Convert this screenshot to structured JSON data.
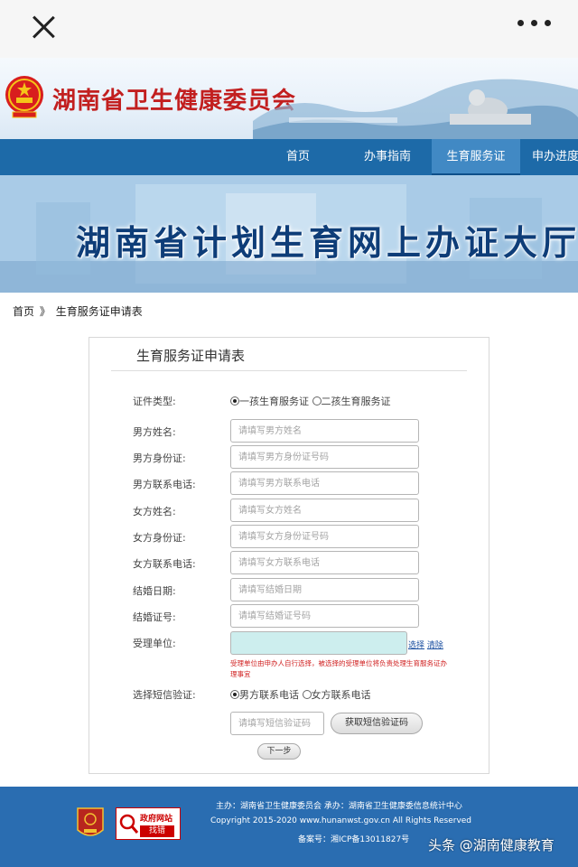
{
  "header": {
    "site_title": "湖南省卫生健康委员会"
  },
  "nav": {
    "items": [
      {
        "label": "首页"
      },
      {
        "label": "办事指南"
      },
      {
        "label": "生育服务证"
      },
      {
        "label": "申办进度查"
      }
    ],
    "active_index": 2
  },
  "banner": {
    "title": "湖南省计划生育网上办证大厅"
  },
  "breadcrumb": {
    "home": "首页",
    "separator": "》",
    "current": "生育服务证申请表"
  },
  "form": {
    "title": "生育服务证申请表",
    "cert_type": {
      "label": "证件类型:",
      "options": [
        "一孩生育服务证",
        "二孩生育服务证"
      ],
      "selected": "一孩生育服务证"
    },
    "fields": [
      {
        "label": "男方姓名:",
        "placeholder": "请填写男方姓名",
        "value": ""
      },
      {
        "label": "男方身份证:",
        "placeholder": "请填写男方身份证号码",
        "value": ""
      },
      {
        "label": "男方联系电话:",
        "placeholder": "请填写男方联系电话",
        "value": ""
      },
      {
        "label": "女方姓名:",
        "placeholder": "请填写女方姓名",
        "value": ""
      },
      {
        "label": "女方身份证:",
        "placeholder": "请填写女方身份证号码",
        "value": ""
      },
      {
        "label": "女方联系电话:",
        "placeholder": "请填写女方联系电话",
        "value": ""
      },
      {
        "label": "结婚日期:",
        "placeholder": "请填写结婚日期",
        "value": ""
      },
      {
        "label": "结婚证号:",
        "placeholder": "请填写结婚证号码",
        "value": ""
      }
    ],
    "unit": {
      "label": "受理单位:",
      "select_link": "选择",
      "clear_link": "清除",
      "hint": "受理单位由申办人自行选择，被选择的受理单位将负责处理生育服务证办理事宜"
    },
    "sms": {
      "label": "选择短信验证:",
      "options": [
        "男方联系电话",
        "女方联系电话"
      ],
      "selected": "男方联系电话",
      "code_placeholder": "请填写短信验证码",
      "get_code_button": "获取短信验证码"
    },
    "next_button": "下一步"
  },
  "footer": {
    "line1": "主办：湖南省卫生健康委员会    承办：湖南省卫生健康委信息统计中心",
    "line2": "Copyright 2015-2020   www.hunanwst.gov.cn   All Rights Reserved",
    "line3": "备案号：湘ICP备13011827号",
    "party_badge_text": "党政机关",
    "gov_badge_top": "政府网站",
    "gov_badge_bottom": "找错"
  },
  "watermark": "头条 @湖南健康教育",
  "colors": {
    "nav_bg": "#1d6aa8",
    "nav_active_bg": "#4189c4",
    "title_red": "#c21f1f",
    "footer_bg": "#2a6db1",
    "unit_box_bg": "#cdeeee",
    "hint_red": "#d02020"
  }
}
